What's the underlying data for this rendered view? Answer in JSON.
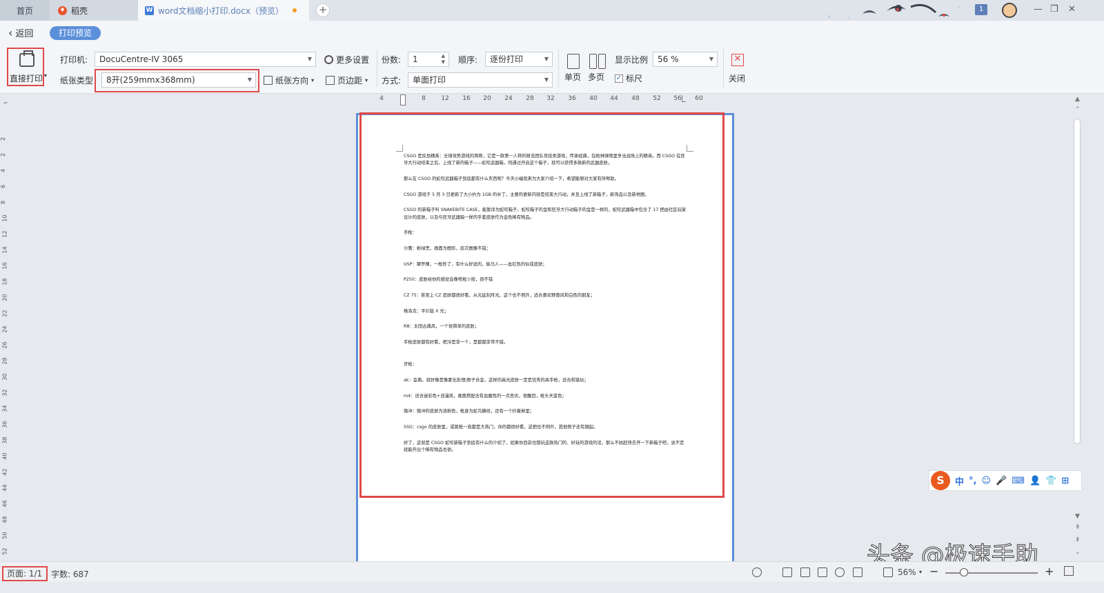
{
  "tabs": {
    "home": "首页",
    "daoke": "稻壳",
    "doc": "word文档缩小打印.docx（预览）",
    "add": "+"
  },
  "window": {
    "notification_count": "1",
    "minimize": "—",
    "restore": "❐",
    "close": "✕"
  },
  "titlebar": {
    "back": "返回",
    "mode": "打印预览"
  },
  "toolbar": {
    "direct_print": "直接打印",
    "printer_label": "打印机:",
    "printer_value": "DocuCentre-IV 3065",
    "more_settings": "更多设置",
    "paper_type_label": "纸张类型",
    "paper_type_value": "8开(259mmx368mm)",
    "orientation": "纸张方向",
    "margins": "页边距",
    "copies_label": "份数:",
    "copies_value": "1",
    "order_label": "顺序:",
    "order_value": "逐份打印",
    "mode_label": "方式:",
    "mode_value": "单面打印",
    "single_page": "单页",
    "multi_page": "多页",
    "zoom_label": "显示比例",
    "zoom_value": "56 %",
    "ruler": "标尺",
    "close": "关闭"
  },
  "ruler": {
    "h": [
      "4",
      "4",
      "8",
      "12",
      "16",
      "20",
      "24",
      "28",
      "32",
      "36",
      "40",
      "44",
      "48",
      "52",
      "56",
      "60"
    ],
    "v": [
      "2",
      "2",
      "4",
      "6",
      "8",
      "10",
      "12",
      "14",
      "16",
      "18",
      "20",
      "22",
      "24",
      "26",
      "28",
      "30",
      "32",
      "34",
      "36",
      "38",
      "40",
      "42",
      "44",
      "46",
      "48",
      "50",
      "52"
    ]
  },
  "document": {
    "paragraphs": [
      "CSGO 是反恐精英：全球攻势游戏的简称，它是一款第一人称的射击团队竞技类游戏，传承经典，在枪林弹雨里争当战场上的精英。而 CSGO 在狂牙大行动结束之后，上线了新的箱子——蛇咬武器箱，同通过开启这个箱子，就可以获得多款新的武器皮肤。",
      "那么在 CSGO 的蛇咬武器箱子到底都有什么东西呢？今天小编就来为大家介绍一下，希望能够对大家有所帮助。",
      "CSGO 游戏于 5 月 3 日更新了大小约为 1GB 的补丁，主要的更新内容是结束大行动，并且上线了新箱子，新饰品以及新地图。",
      "CSGO 的新箱子叫 SNAKEBITE CASE，能暂译为蛇咬箱子，蛇咬箱子的金和狂牙大行动箱子的金是一样的，蛇咬武器箱中包含了 17 把由社区玩家设计的皮肤，以及与狂牙武器箱一样的手套皮肤作为金色稀有物品。",
      "手枪：",
      "沙鹰：粉绿黑，画面为图形，层次图像不错；",
      "USP：摩罗棵，一枪秒了，有什么好说的，偷马人——血红色的似成皮肤；",
      "P250：皮肤给你的感觉会像喷枪少按，很不错",
      "CZ 75：甚至上 CZ 皮肤都很好看，从元延刻月光，这个也不例外，适合喜欢野兽风和白色的朋友；",
      "格洛克：平价版 X 光；",
      "R8：太阳古典风，一个很简单的皮肤；",
      "手枪皮肤都有好看，把冷是非一个，是都都非常不错。",
      "步枪：",
      "ak：金典，就好像是像素化处理/原子合金，这样的高光皮肤一定是优秀的高手枪，适合和谐玩；",
      "m4：适合迷彩色+浪漫风，画面搭配含有血腥性的一点恶劣，很醒目，枪头天蓝色；",
      "微冲：微冲的皮肤为浪粉色，枪身为蛇鸟鳞纹，还有一个抄着掉里；",
      "SSG：csgo 的皮肤里，或狙枪一直都是大热门，你的都很好看，这把也不例外，其他例子还有翘起。",
      "好了，这就是 CSGO 蛇咬新箱子到底有什么的介绍了，如果你目前也想玩这款热门的、好玩的游戏的话，那么不妨赶快去开一下新箱子吧，说不定就能开出个稀有物品也很。"
    ]
  },
  "ime": {
    "logo": "S",
    "items": [
      "中",
      "°,",
      "☺",
      "🎤",
      "⌨",
      "👤",
      "👕",
      "⊞"
    ]
  },
  "watermark": "头条 @极速手助",
  "statusbar": {
    "page": "页面: 1/1",
    "wordcount": "字数: 687",
    "zoom": "56%",
    "zoom_out": "−",
    "zoom_in": "+",
    "zoom_level": 0.2
  },
  "colors": {
    "highlight": "#e04848",
    "accent": "#5b8fd9",
    "ime_brand": "#ea5a1f"
  }
}
